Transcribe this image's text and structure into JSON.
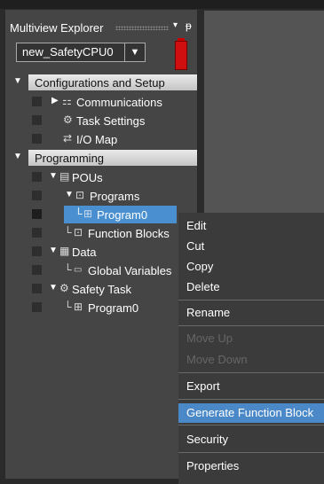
{
  "panel": {
    "title": "Multiview Explorer",
    "dropdown_glyph": "▾",
    "pin_glyph": "ᵽ",
    "device_selector": "new_SafetyCPU0",
    "device_arrow": "▼"
  },
  "tree": {
    "config_header": "Configurations and Setup",
    "communications": "Communications",
    "task_settings": "Task Settings",
    "io_map": "I/O Map",
    "programming_header": "Programming",
    "pous": "POUs",
    "programs": "Programs",
    "program0": "Program0",
    "function_blocks": "Function Blocks",
    "data": "Data",
    "global_variables": "Global Variables",
    "safety_task": "Safety Task",
    "safety_program0": "Program0"
  },
  "context_menu": {
    "edit": "Edit",
    "cut": "Cut",
    "copy": "Copy",
    "delete": "Delete",
    "rename": "Rename",
    "move_up": "Move Up",
    "move_down": "Move Down",
    "export": "Export",
    "generate_function_block": "Generate Function Block",
    "security": "Security",
    "properties": "Properties"
  }
}
